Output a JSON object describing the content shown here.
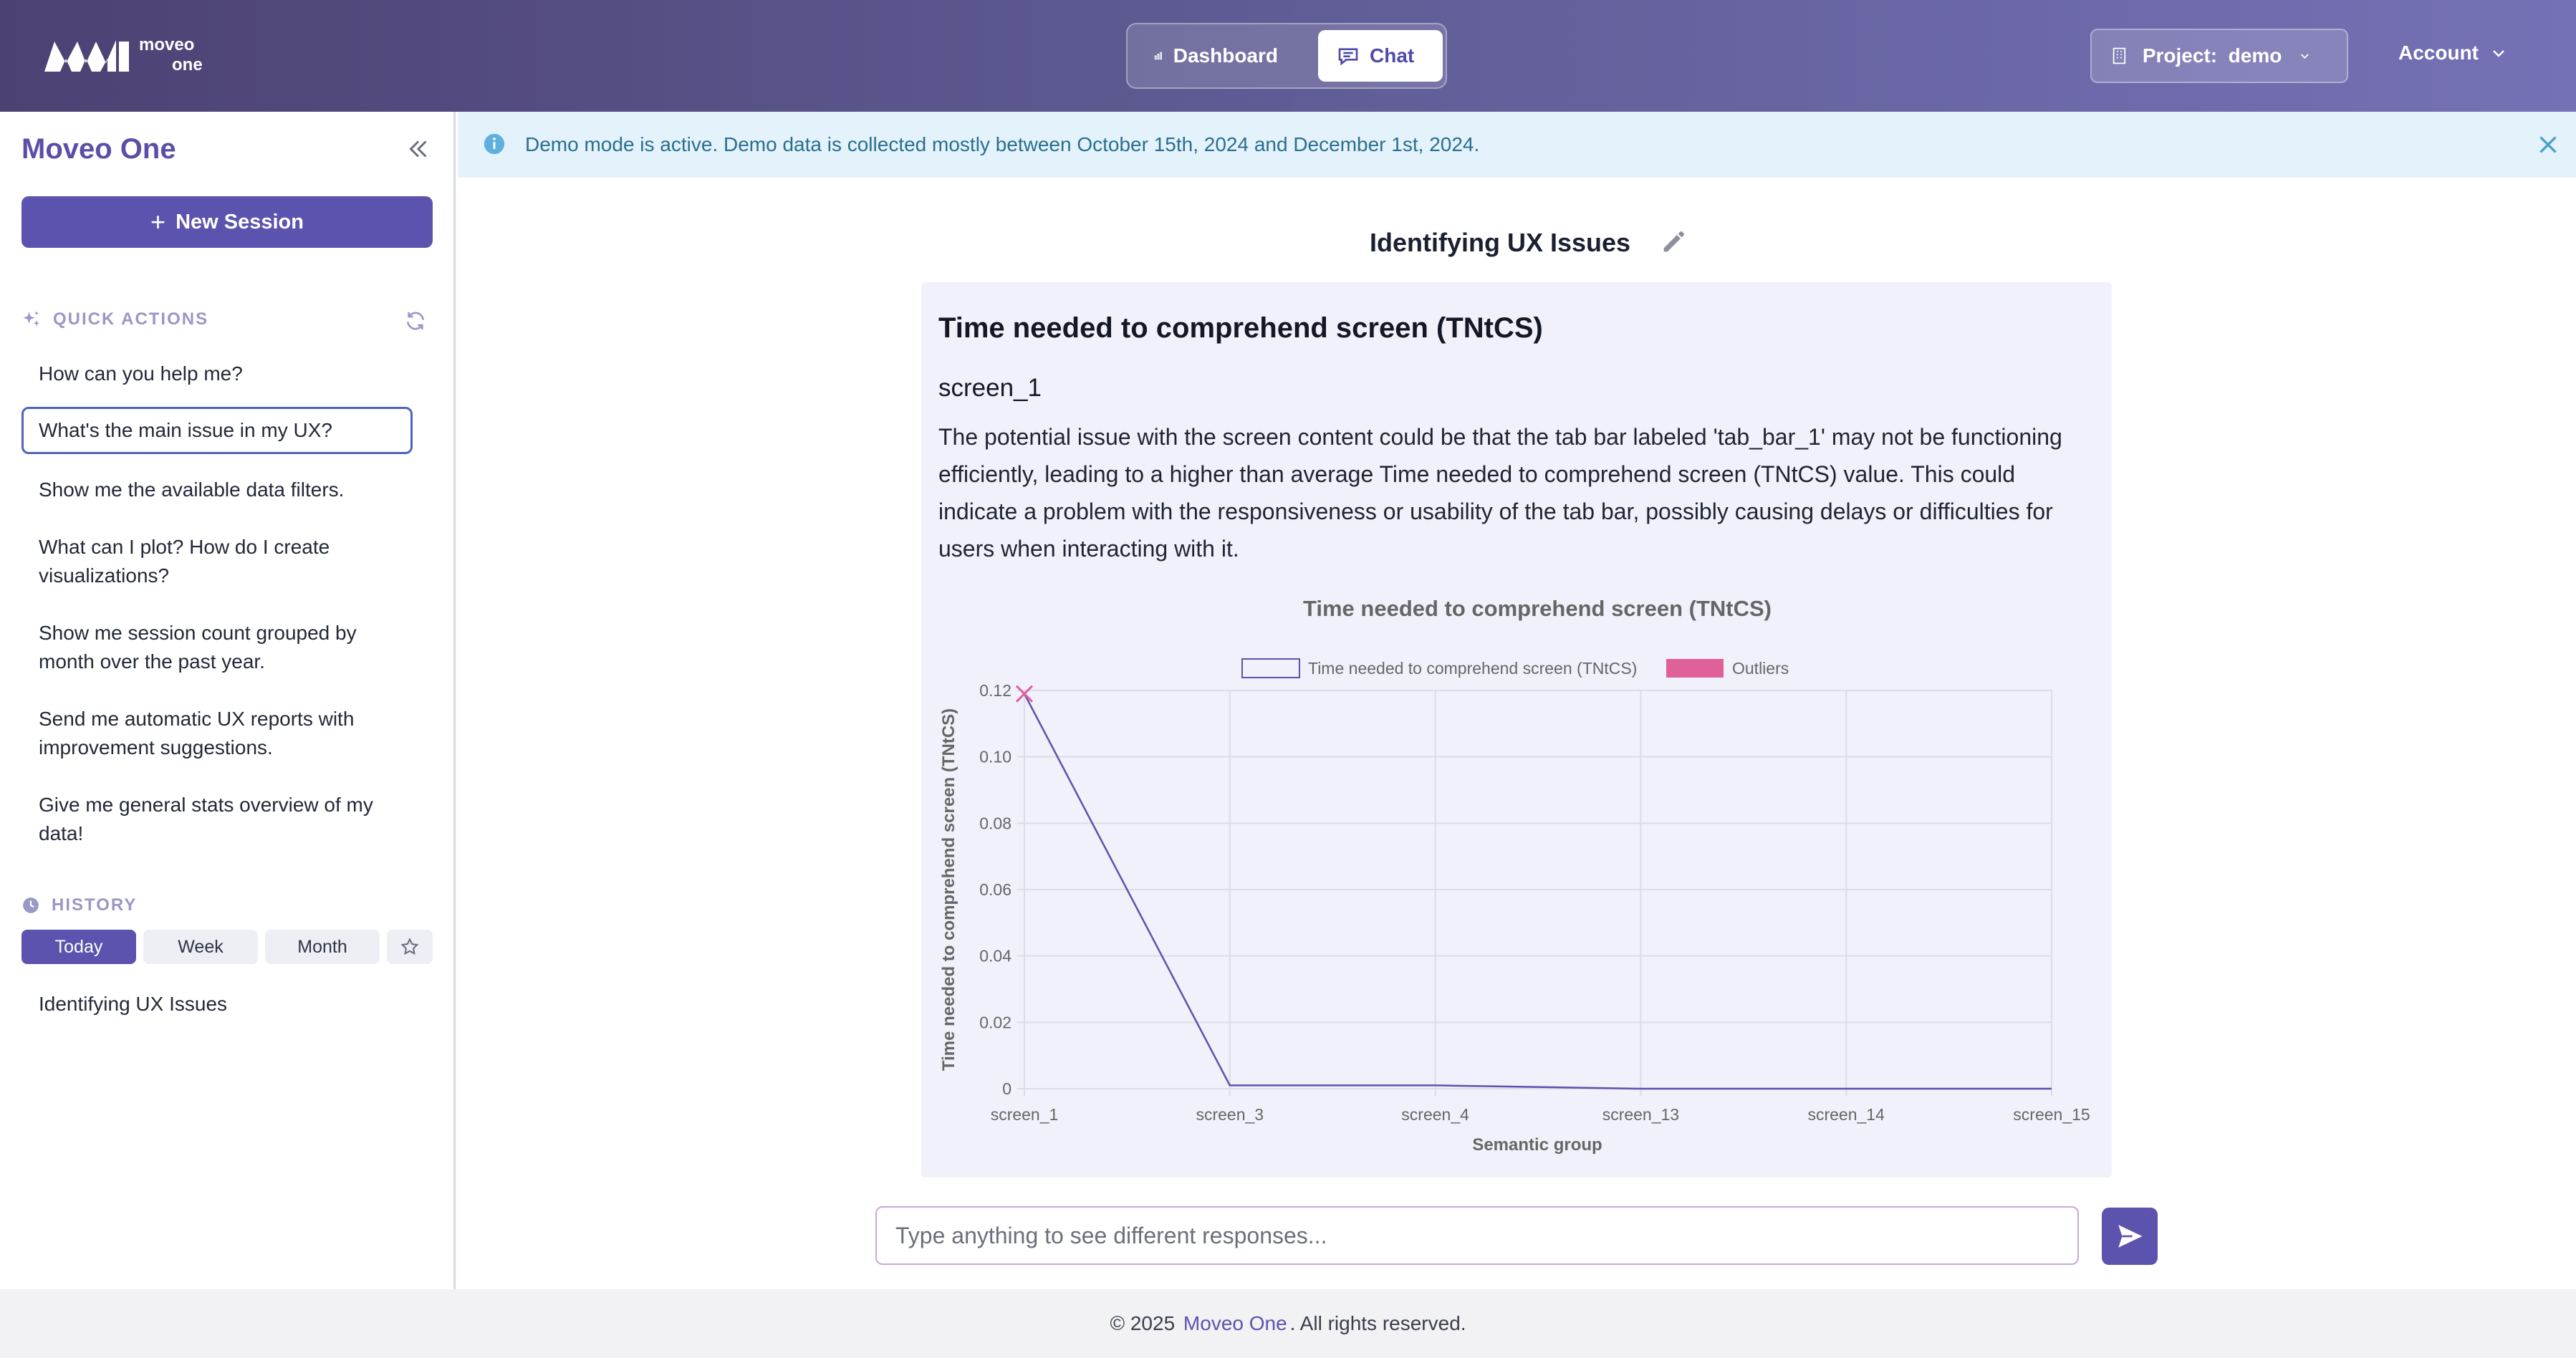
{
  "header": {
    "logo_line1": "moveo",
    "logo_line2": "one",
    "nav": {
      "dashboard": "Dashboard",
      "chat": "Chat"
    },
    "project_label": "Project:",
    "project_value": "demo",
    "account": "Account"
  },
  "sidebar": {
    "brand": "Moveo One",
    "new_session": "New Session",
    "quick_actions_label": "QUICK ACTIONS",
    "quick_actions": [
      "How can you help me?",
      "What's the main issue in my UX?",
      "Show me the available data filters.",
      "What can I plot? How do I create visualizations?",
      "Show me session count grouped by month over the past year.",
      "Send me automatic UX reports with improvement suggestions.",
      "Give me general stats overview of my data!"
    ],
    "history_label": "HISTORY",
    "history_tabs": [
      "Today",
      "Week",
      "Month"
    ],
    "history_items": [
      "Identifying UX Issues"
    ]
  },
  "banner": {
    "text": "Demo mode is active. Demo data is collected mostly between October 15th, 2024 and December 1st, 2024."
  },
  "conversation": {
    "title": "Identifying UX Issues",
    "heading": "Time needed to comprehend screen (TNtCS)",
    "subheading": "screen_1",
    "body": "The potential issue with the screen content could be that the tab bar labeled 'tab_bar_1' may not be functioning efficiently, leading to a higher than average Time needed to comprehend screen (TNtCS) value. This could indicate a problem with the responsiveness or usability of the tab bar, possibly causing delays or difficulties for users when interacting with it."
  },
  "chart_data": {
    "type": "line",
    "title": "Time needed to comprehend screen (TNtCS)",
    "xlabel": "Semantic group",
    "ylabel": "Time needed to comprehend screen (TNtCS)",
    "categories": [
      "screen_1",
      "screen_3",
      "screen_4",
      "screen_13",
      "screen_14",
      "screen_15"
    ],
    "series": [
      {
        "name": "Time needed to comprehend screen (TNtCS)",
        "values": [
          0.119,
          0.001,
          0.001,
          0.0,
          0.0,
          0.0
        ],
        "color": "#5b53ae"
      }
    ],
    "outliers": {
      "name": "Outliers",
      "points": [
        {
          "x": "screen_1",
          "y": 0.119
        }
      ],
      "color": "#e0609a"
    },
    "ylim": [
      0,
      0.12
    ],
    "yticks": [
      "0",
      "0.02",
      "0.04",
      "0.06",
      "0.08",
      "0.10",
      "0.12"
    ],
    "yticks_values": [
      0,
      0.02,
      0.04,
      0.06,
      0.08,
      0.1,
      0.12
    ],
    "grid": true,
    "legend": "top"
  },
  "input": {
    "placeholder": "Type anything to see different responses..."
  },
  "footer": {
    "prefix": "© 2025",
    "brand": "Moveo One",
    "suffix": ". All rights reserved."
  },
  "colors": {
    "accent": "#5b53ae",
    "header_start": "#4c4173",
    "header_end": "#7571b6",
    "banner_bg": "#e3f2fb"
  }
}
